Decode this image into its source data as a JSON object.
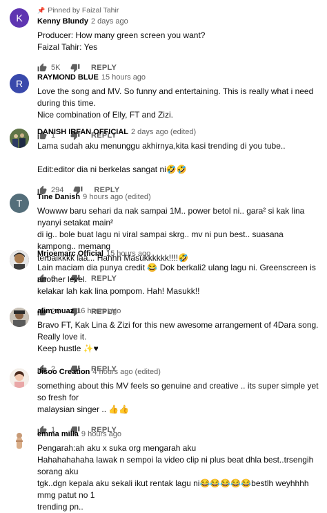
{
  "comments": [
    {
      "pinned_label": "Pinned by Faizal Tahir",
      "author": "Kenny Blundy",
      "time": "2 days ago",
      "lines": [
        "Producer: How many green screen you want?",
        "Faizal Tahir: Yes"
      ],
      "likes": "5K",
      "reply_label": "REPLY",
      "avatar": {
        "letter": "K",
        "color": "#5e35b1"
      }
    },
    {
      "author": "RAYMOND BLUE",
      "time": "15 hours ago",
      "lines": [
        "Love the song and MV. So funny and entertaining. This is really what i need during this time.",
        "Nice combination of Elly, FT and Zizi."
      ],
      "likes": "1",
      "reply_label": "REPLY",
      "avatar": {
        "letter": "R",
        "color": "#3949ab"
      }
    },
    {
      "author": "DANISH IRFAN OFFICIAL",
      "time": "2 days ago (edited)",
      "lines": [
        "Lama sudah aku menunggu akhirnya,kita kasi trending di you tube..",
        "",
        "Edit:editor dia ni berkelas sangat ni🤣🤣"
      ],
      "likes": "294",
      "reply_label": "REPLY",
      "avatar": {
        "letter": "",
        "color": "#4a5d3a"
      }
    },
    {
      "author": "Tine Danish",
      "time": "9 hours ago (edited)",
      "lines": [
        "Wowww baru sehari da nak sampai 1M.. power betol ni.. gara² si kak lina nyanyi setakat main²",
        "di ig.. bole buat lagu ni viral sampai skrg.. mv ni pun best.. suasana kampong.. memang",
        "terbaikkkk laà... Hahhh Masukkkkkk!!!!🤣"
      ],
      "likes": "3",
      "reply_label": "REPLY",
      "avatar": {
        "letter": "T",
        "color": "#546e7a"
      }
    },
    {
      "author": "Mrjoemarc Official",
      "time": "15 hours ago",
      "lines": [
        "Lain maciam dia punya credit 😂 Dok berkali2 ulang lagu ni. Greenscreen is another level.",
        "kelakar lah kak lina pompom. Hah! Masukk!!"
      ],
      "likes": "24",
      "reply_label": "REPLY",
      "avatar": {
        "letter": "",
        "color": "#6d4c41"
      }
    },
    {
      "author": "alim muaz",
      "time": "16 hours ago",
      "lines": [
        "Bravo FT, Kak Lina & Zizi for this new awesome arrangement of 4Dara song. Really love it.",
        "Keep hustle ✨♥"
      ],
      "likes": "2",
      "reply_label": "REPLY",
      "avatar": {
        "letter": "",
        "color": "#8d6e63"
      }
    },
    {
      "author": "Jisoo Creation",
      "time": "4 hours ago (edited)",
      "lines": [
        "something about this MV feels so genuine and creative .. its super simple yet so fresh for",
        "malaysian singer .. 👍👍"
      ],
      "likes": "1",
      "reply_label": "REPLY",
      "avatar": {
        "letter": "",
        "color": "#d7b8a8"
      }
    },
    {
      "author": "emma milla",
      "time": "9 hours ago",
      "lines": [
        "Pengarah:ah aku x suka org mengarah aku",
        "Hahahahahaha lawak n sempoi la video clip ni plus beat dhla best..trsengih sorang aku",
        "tgk..dgn kepala aku sekali ikut rentak lagu ni😂😂😂😂😂bestlh weyhhhh mmg patut no 1",
        "trending pn.."
      ],
      "likes": "",
      "reply_label": "",
      "avatar": {
        "letter": "",
        "color": "#f2ece6"
      }
    }
  ]
}
